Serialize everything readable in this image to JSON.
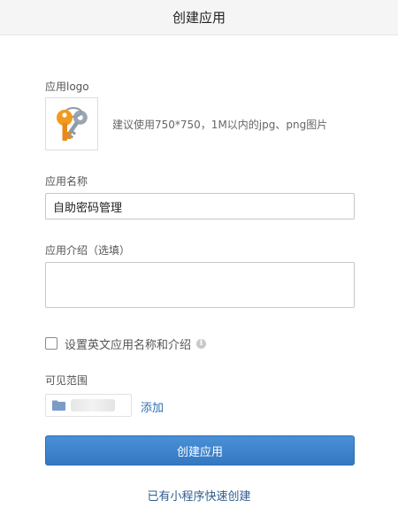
{
  "header": {
    "title": "创建应用"
  },
  "logo": {
    "label": "应用logo",
    "hint": "建议使用750*750，1M以内的jpg、png图片",
    "icon": "key-icon",
    "icon_color": "#f29a1f"
  },
  "app_name": {
    "label": "应用名称",
    "value": "自助密码管理"
  },
  "app_intro": {
    "label": "应用介绍（选填）",
    "value": ""
  },
  "english_option": {
    "label": "设置英文应用名称和介绍",
    "checked": false
  },
  "scope": {
    "label": "可见范围",
    "add_label": "添加",
    "folder_icon_color": "#7a9cc6"
  },
  "submit": {
    "label": "创建应用",
    "color": "#3a82cb"
  },
  "quick_create": {
    "label": "已有小程序快速创建"
  }
}
